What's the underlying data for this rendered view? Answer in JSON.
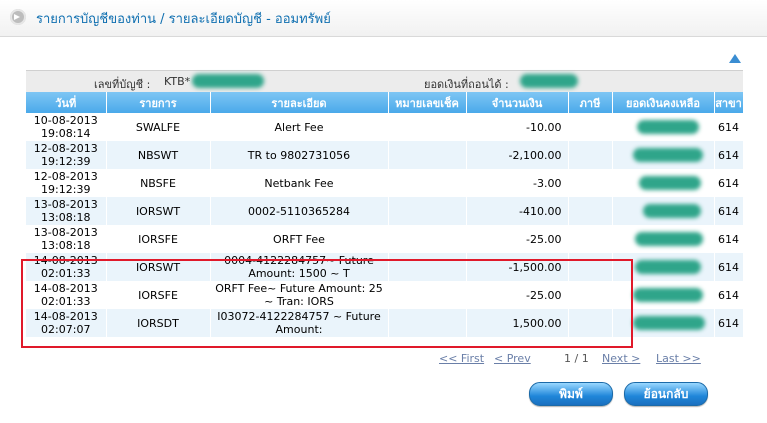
{
  "page": {
    "title": "รายการบัญชีของท่าน / รายละเอียดบัญชี - ออมทรัพย์"
  },
  "summary": {
    "account_label": "เลขที่บัญชี :",
    "account_value": "KTB*",
    "balance_label": "ยอดเงินที่ถอนได้ :"
  },
  "table": {
    "headers": [
      "วันที่",
      "รายการ",
      "รายละเอียด",
      "หมายเลขเช็ค",
      "จำนวนเงิน",
      "ภาษี",
      "ยอดเงินคงเหลือ",
      "สาขา"
    ],
    "rows": [
      {
        "date": "10-08-2013",
        "time": "19:08:14",
        "code": "SWALFE",
        "detail": "Alert Fee",
        "cheque": "",
        "amount": "-10.00",
        "tax": "",
        "branch": "614"
      },
      {
        "date": "12-08-2013",
        "time": "19:12:39",
        "code": "NBSWT",
        "detail": "TR to 9802731056",
        "cheque": "",
        "amount": "-2,100.00",
        "tax": "",
        "branch": "614"
      },
      {
        "date": "12-08-2013",
        "time": "19:12:39",
        "code": "NBSFE",
        "detail": "Netbank Fee",
        "cheque": "",
        "amount": "-3.00",
        "tax": "",
        "branch": "614"
      },
      {
        "date": "13-08-2013",
        "time": "13:08:18",
        "code": "IORSWT",
        "detail": "0002-5110365284",
        "cheque": "",
        "amount": "-410.00",
        "tax": "",
        "branch": "614"
      },
      {
        "date": "13-08-2013",
        "time": "13:08:18",
        "code": "IORSFE",
        "detail": "ORFT Fee",
        "cheque": "",
        "amount": "-25.00",
        "tax": "",
        "branch": "614"
      },
      {
        "date": "14-08-2013",
        "time": "02:01:33",
        "code": "IORSWT",
        "detail": "0004-4122284757~ Future Amount: 1500 ~ T",
        "cheque": "",
        "amount": "-1,500.00",
        "tax": "",
        "branch": "614"
      },
      {
        "date": "14-08-2013",
        "time": "02:01:33",
        "code": "IORSFE",
        "detail": "ORFT Fee~ Future Amount: 25 ~ Tran: IORS",
        "cheque": "",
        "amount": "-25.00",
        "tax": "",
        "branch": "614"
      },
      {
        "date": "14-08-2013",
        "time": "02:07:07",
        "code": "IORSDT",
        "detail": "I03072-4122284757 ~ Future Amount:",
        "cheque": "",
        "amount": "1,500.00",
        "tax": "",
        "branch": "614"
      }
    ]
  },
  "pager": {
    "first": "<< First",
    "prev": "< Prev",
    "page": "1 / 1",
    "next": "Next >",
    "last": "Last >>"
  },
  "buttons": {
    "print": "พิมพ์",
    "back": "ย้อนกลับ"
  },
  "colors": {
    "title": "#0f6fb0",
    "header_bg": "#4aa9ea",
    "row_alt": "#eaf4fb",
    "highlight_box": "#e0192a",
    "redaction": "#2fa58a"
  }
}
